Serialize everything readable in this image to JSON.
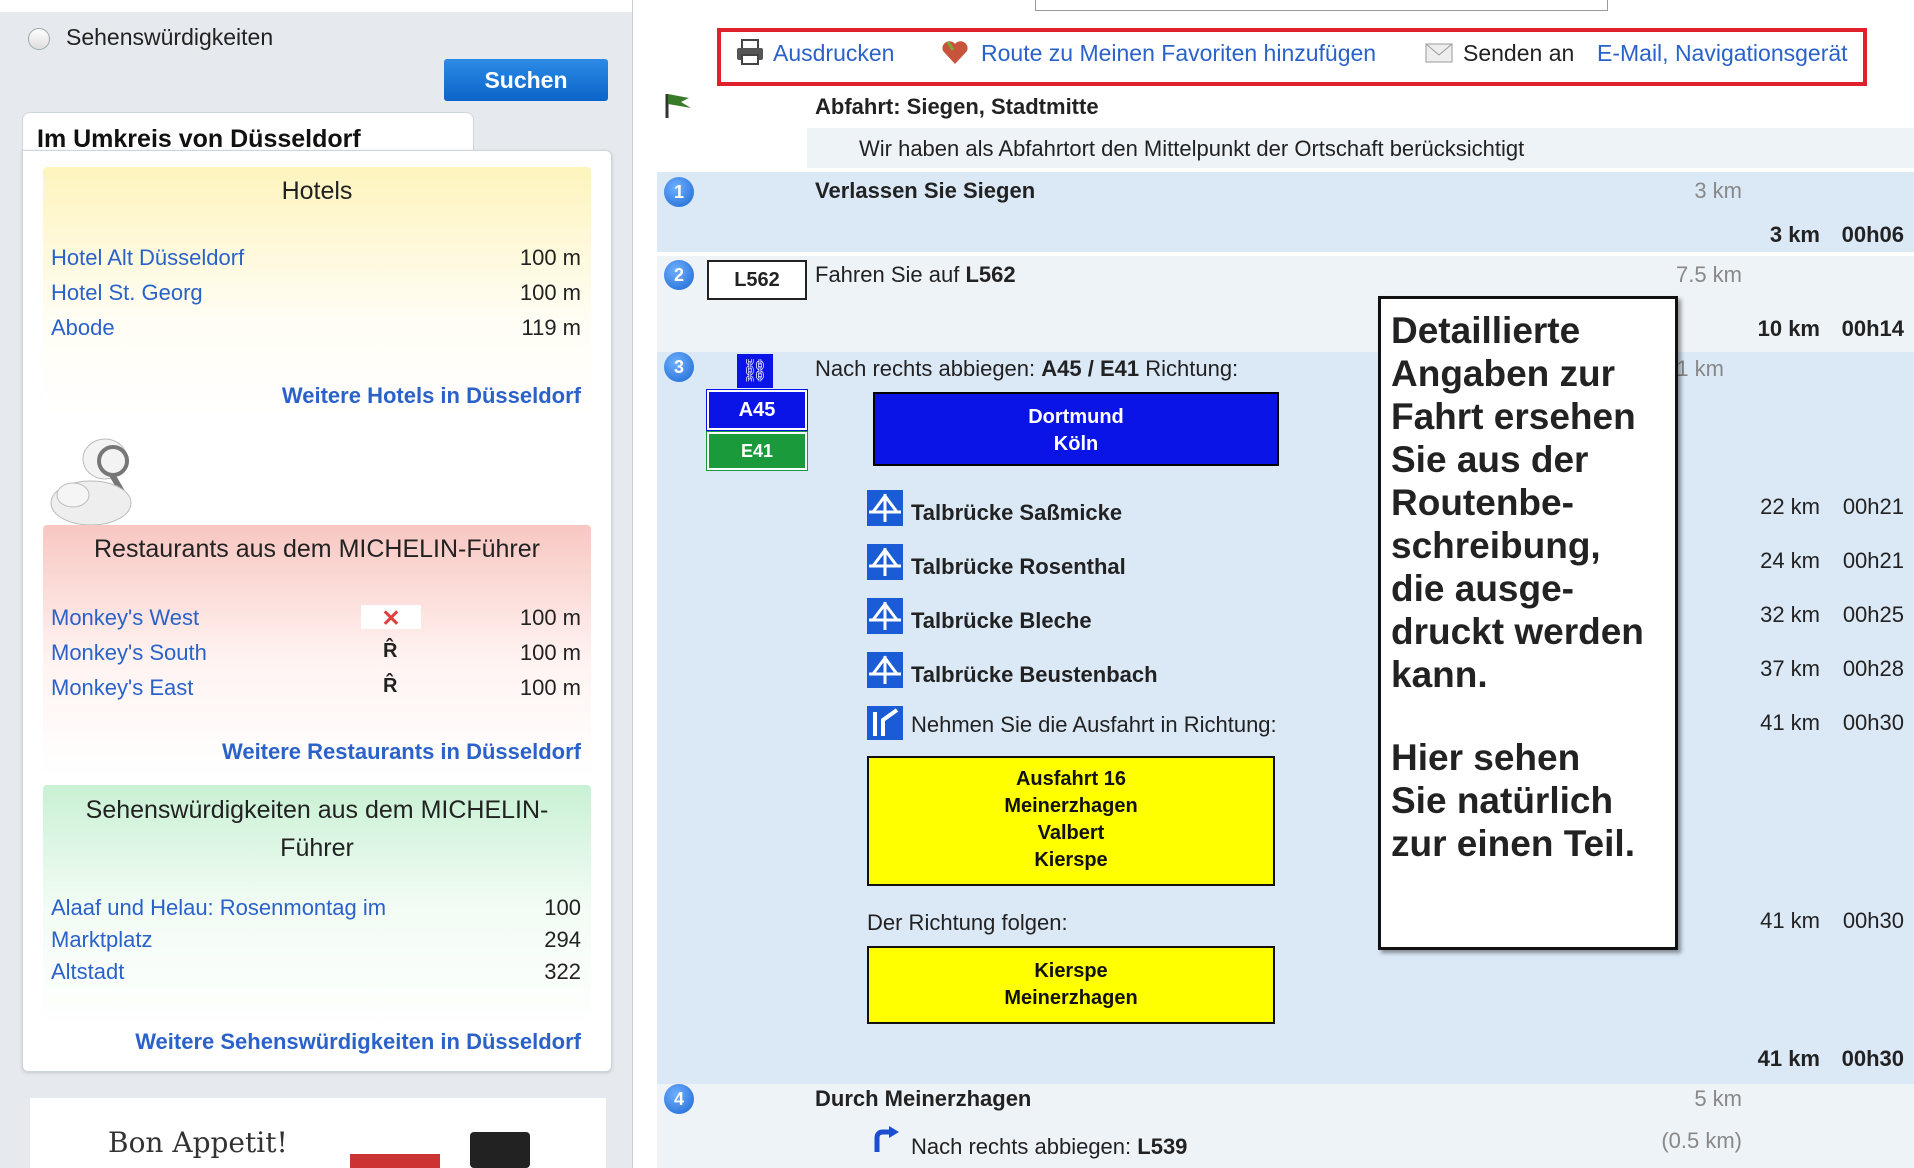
{
  "search": {
    "radio_label": "Sehenswürdigkeiten",
    "button_label": "Suchen"
  },
  "nearby": {
    "title": "Im Umkreis von Düsseldorf",
    "hotels": {
      "title": "Hotels",
      "items": [
        {
          "name": "Hotel Alt Düsseldorf",
          "dist": "100 m"
        },
        {
          "name": "Hotel St. Georg",
          "dist": "100 m"
        },
        {
          "name": "Abode",
          "dist": "119 m"
        }
      ],
      "more": "Weitere Hotels in Düsseldorf"
    },
    "restaurants": {
      "title": "Restaurants aus dem MICHELIN-Führer",
      "items": [
        {
          "name": "Monkey's West",
          "dist": "100 m",
          "icon": "michelin-fork-icon"
        },
        {
          "name": "Monkey's South",
          "dist": "100 m",
          "icon": "michelin-r-icon"
        },
        {
          "name": "Monkey's East",
          "dist": "100 m",
          "icon": "michelin-r-icon"
        }
      ],
      "more": "Weitere Restaurants in Düsseldorf"
    },
    "sights": {
      "title_line1": "Sehenswürdigkeiten aus dem MICHELIN-",
      "title_line2": "Führer",
      "items": [
        {
          "name": "Alaaf und Helau: Rosenmontag im",
          "dist": "100"
        },
        {
          "name": "Marktplatz",
          "dist": "294"
        },
        {
          "name": "Altstadt",
          "dist": "322"
        }
      ],
      "more": "Weitere Sehenswürdigkeiten in Düsseldorf"
    },
    "promo": "Bon Appetit!"
  },
  "toolbar": {
    "print": "Ausdrucken",
    "favorites": "Route zu Meinen Favoriten hinzufügen",
    "send_label": "Senden an",
    "send_links": "E-Mail, Navigationsgerät"
  },
  "route": {
    "departure": "Abfahrt: Siegen, Stadtmitte",
    "departure_note": "Wir haben als Abfahrtort den Mittelpunkt der Ortschaft berücksichtigt",
    "step1": {
      "num": "1",
      "text": "Verlassen Sie Siegen",
      "km": "3 km",
      "total_km": "3 km",
      "total_time": "00h06"
    },
    "step2": {
      "num": "2",
      "badge": "L562",
      "text_prefix": "Fahren Sie auf ",
      "road": "L562",
      "km": "7.5 km",
      "total_km": "10 km",
      "total_time": "00h14"
    },
    "step3": {
      "num": "3",
      "text_prefix": "Nach rechts abbiegen: ",
      "road": "A45 / E41",
      "text_suffix": " Richtung:",
      "km_partial": "1 km",
      "badge_a": "A45",
      "badge_e": "E41",
      "sign_line1": "Dortmund",
      "sign_line2": "Köln",
      "bridges": [
        {
          "name": "Talbrücke Saßmicke",
          "km": "22 km",
          "time": "00h21"
        },
        {
          "name": "Talbrücke Rosenthal",
          "km": "24 km",
          "time": "00h21"
        },
        {
          "name": "Talbrücke Bleche",
          "km": "32 km",
          "time": "00h25"
        },
        {
          "name": "Talbrücke Beustenbach",
          "km": "37 km",
          "time": "00h28"
        }
      ],
      "exit_text": "Nehmen Sie die Ausfahrt in Richtung:",
      "exit_km": "41 km",
      "exit_time": "00h30",
      "exit_sign": [
        "Ausfahrt 16",
        "Meinerzhagen",
        "Valbert",
        "Kierspe"
      ],
      "follow_text": "Der Richtung folgen:",
      "follow_km": "41 km",
      "follow_time": "00h30",
      "follow_sign": [
        "Kierspe",
        "Meinerzhagen"
      ],
      "total_km": "41 km",
      "total_time": "00h30"
    },
    "step4": {
      "num": "4",
      "text": "Durch Meinerzhagen",
      "km": "5 km",
      "sub_prefix": "Nach rechts abbiegen: ",
      "sub_road": "L539",
      "sub_km": "(0.5 km)"
    }
  },
  "callout": {
    "lines": [
      "Detaillierte",
      "Angaben zur",
      "Fahrt ersehen",
      "Sie aus der",
      "Routenbe-",
      "schreibung,",
      "die ausge-",
      "druckt werden",
      "kann.",
      "",
      "Hier sehen",
      "Sie natürlich",
      "zur einen Teil."
    ]
  },
  "colors": {
    "link": "#2a62c9",
    "highlight_border": "#e0202a",
    "motorway_blue": "#0a14e6",
    "sign_yellow": "#ffff00",
    "euro_green": "#1a9a3a"
  }
}
